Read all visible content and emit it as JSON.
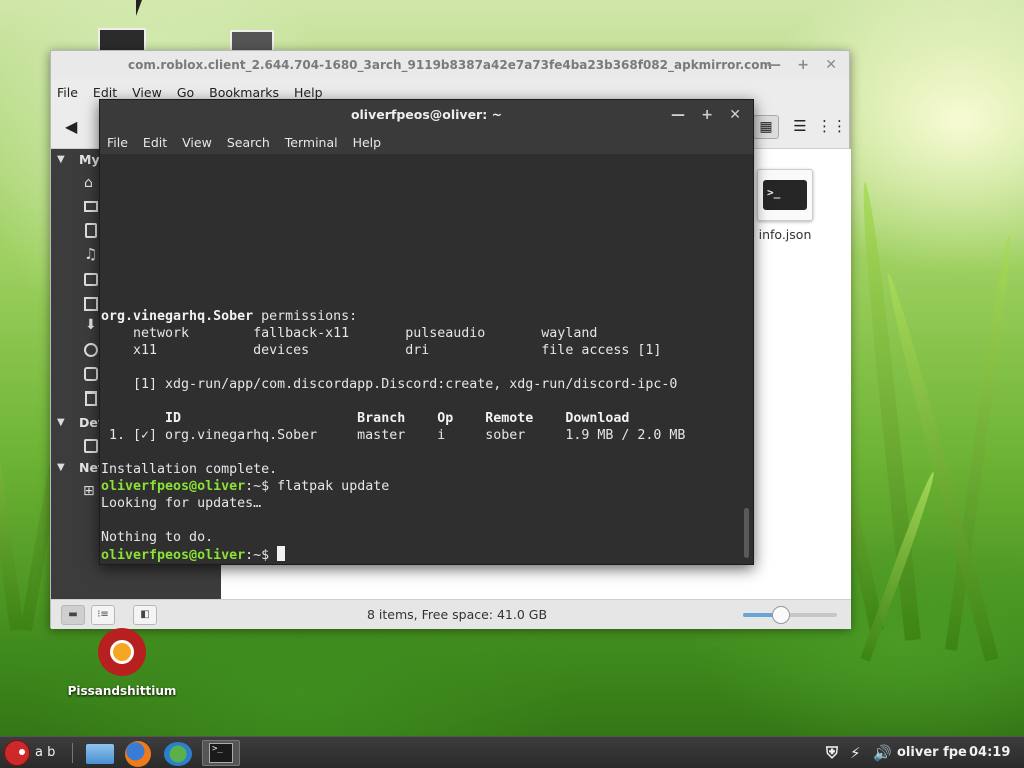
{
  "desktop": {
    "icon_label": "Pissandshittium"
  },
  "file_manager": {
    "title": "com.roblox.client_2.644.704-1680_3arch_9119b8387a42e7a73fe4ba23b368f082_apkmirror.com",
    "menu": [
      "File",
      "Edit",
      "View",
      "Go",
      "Bookmarks",
      "Help"
    ],
    "sidebar_sections": [
      "My",
      "Dev",
      "Net"
    ],
    "file_name": "info.json",
    "status_text": "8 items, Free space: 41.0 GB",
    "zoom_level": 0.4
  },
  "terminal": {
    "title": "oliverfpeos@oliver: ~",
    "menu": [
      "File",
      "Edit",
      "View",
      "Search",
      "Terminal",
      "Help"
    ],
    "lines": {
      "l1_name": "org.vinegarhq.Sober",
      "l1_rest": " permissions:",
      "l2": "    network        fallback-x11       pulseaudio       wayland",
      "l3": "    x11            devices            dri              file access [1]",
      "l4": "    [1] xdg-run/app/com.discordapp.Discord:create, xdg-run/discord-ipc-0",
      "l5": "        ID                      Branch    Op    Remote    Download",
      "l6": " 1. [✓] org.vinegarhq.Sober     master    i     sober     1.9 MB / 2.0 MB",
      "l7": "Installation complete.",
      "prompt_user": "oliverfpeos@oliver",
      "prompt_path": ":~$ ",
      "l8_cmd": "flatpak update",
      "l9": "Looking for updates…",
      "l10": "Nothing to do.",
      "l11_cmd": ""
    }
  },
  "taskbar": {
    "menu_text": "a b",
    "clock_user": "oliver fpe",
    "clock_time": "04:19"
  }
}
